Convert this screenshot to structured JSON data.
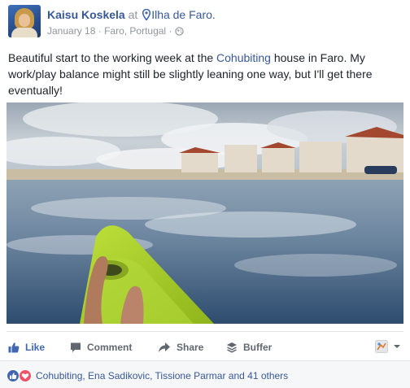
{
  "post": {
    "author": "Kaisu Koskela",
    "at_word": "at",
    "place": "Ilha de Faro.",
    "date": "January 18",
    "location": "Faro, Portugal",
    "dot1": "·",
    "dot2": "·",
    "privacy_icon": "globe-icon",
    "text_before": "Beautiful start to the working week at the ",
    "text_link": "Cohubiting",
    "text_after": " house in Faro. My work/play balance might still be slightly leaning one way, but I'll get there eventually!"
  },
  "actions": {
    "like": "Like",
    "comment": "Comment",
    "share": "Share",
    "buffer": "Buffer"
  },
  "reactions": {
    "icons": [
      "like-reaction-icon",
      "love-reaction-icon"
    ],
    "names": "Cohubiting, Ena Sadikovic, Tissione Parmar and 41 others"
  },
  "colors": {
    "link": "#365899",
    "like_active": "#4267b2",
    "muted": "#90949c",
    "kayak": "#a6cc2a"
  }
}
